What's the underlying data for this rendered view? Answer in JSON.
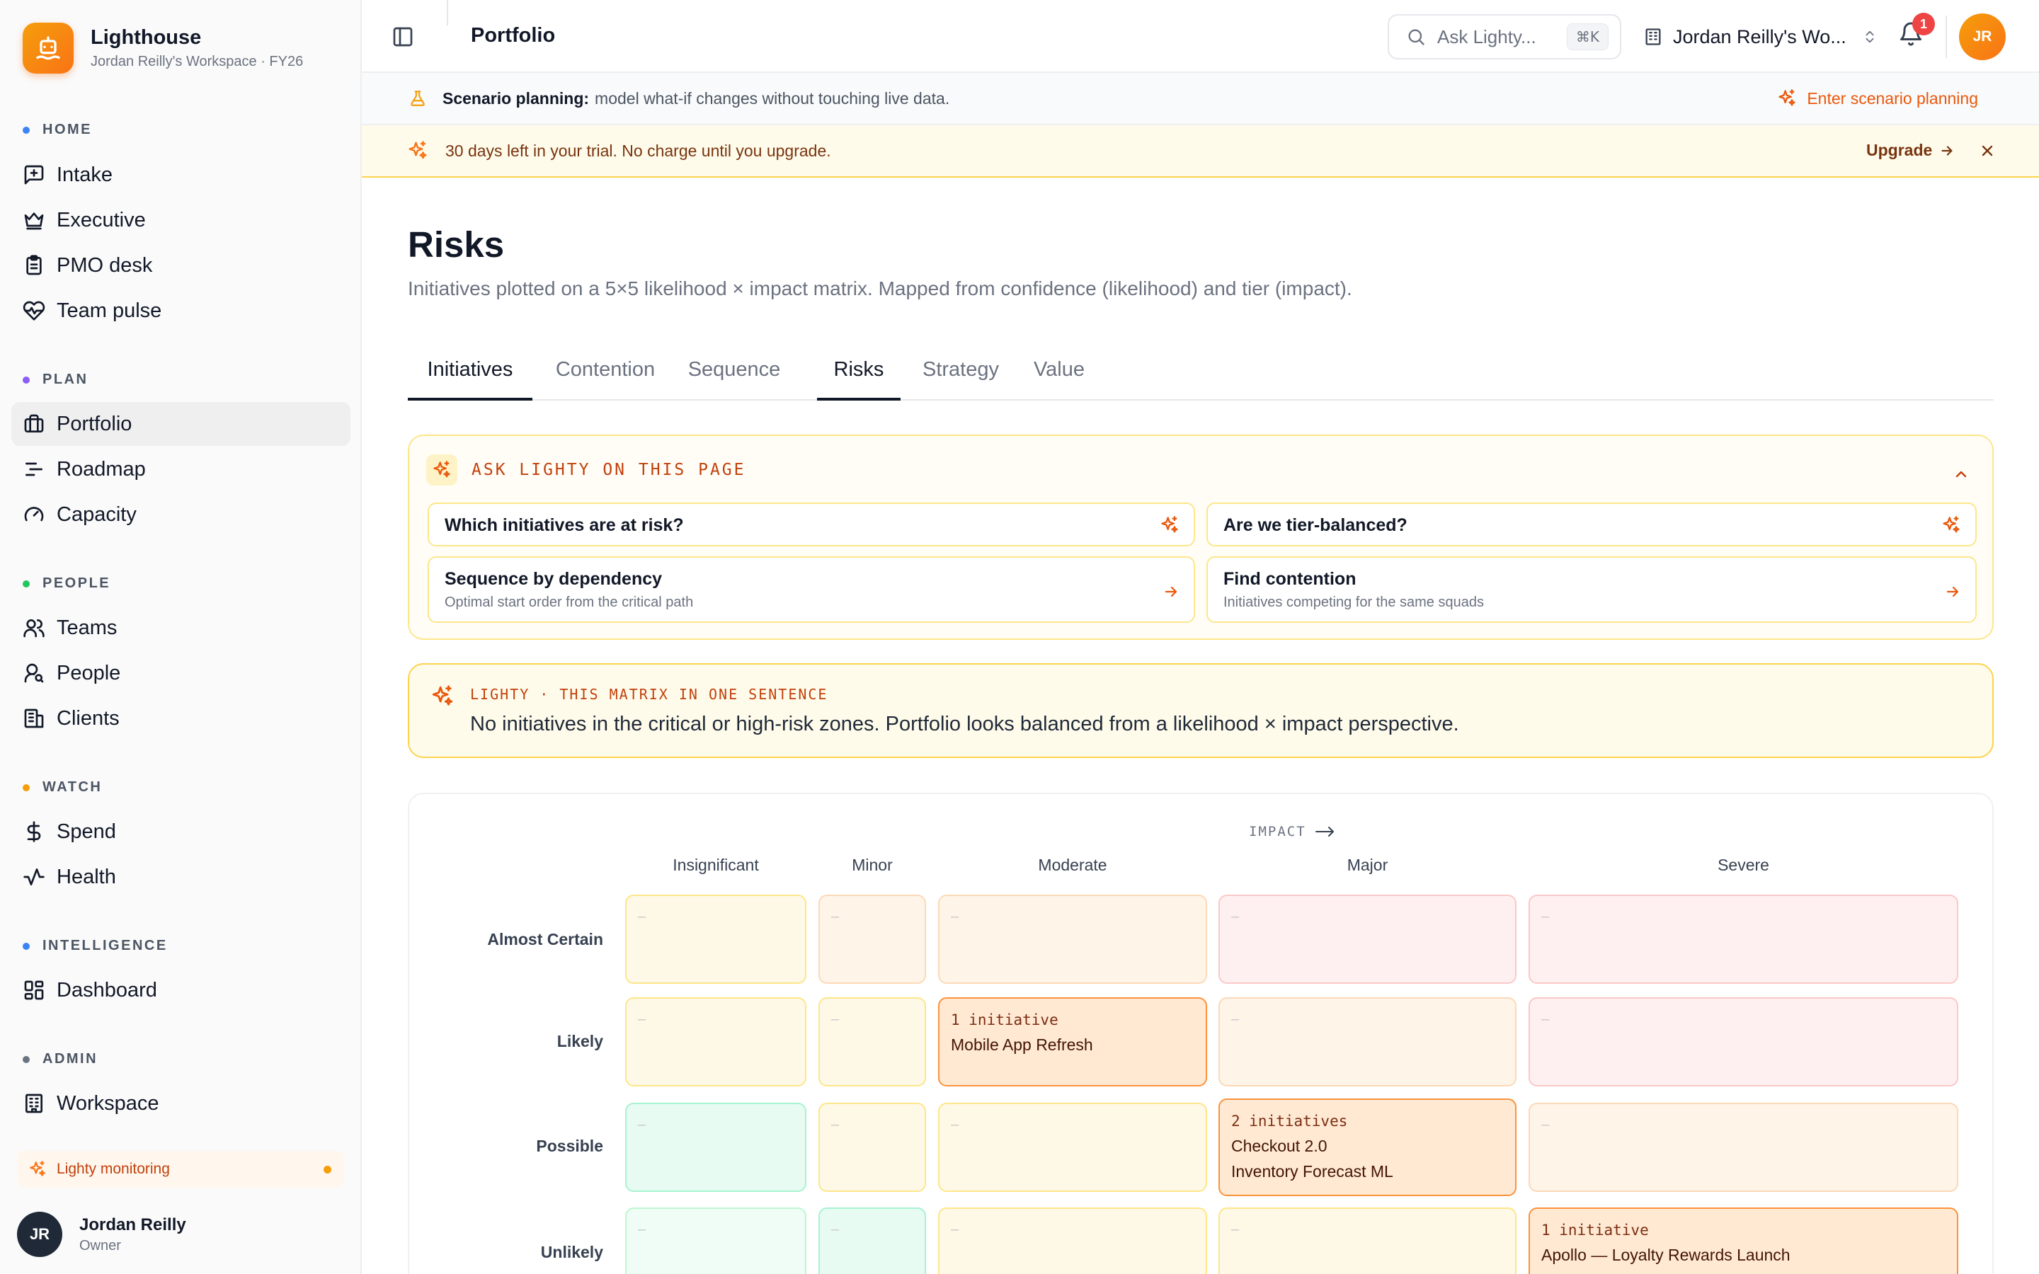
{
  "brand": {
    "name": "Lighthouse",
    "subtitle": "Jordan Reilly's Workspace · FY26"
  },
  "sidebar": {
    "sections": [
      {
        "label": "HOME",
        "color": "#3b82f6"
      },
      {
        "label": "PLAN",
        "color": "#8b5cf6"
      },
      {
        "label": "PEOPLE",
        "color": "#22c55e"
      },
      {
        "label": "WATCH",
        "color": "#f59e0b"
      },
      {
        "label": "INTELLIGENCE",
        "color": "#3b82f6"
      },
      {
        "label": "ADMIN",
        "color": "#6b7280"
      }
    ],
    "items": {
      "intake": "Intake",
      "executive": "Executive",
      "pmo_desk": "PMO desk",
      "team_pulse": "Team pulse",
      "portfolio": "Portfolio",
      "roadmap": "Roadmap",
      "capacity": "Capacity",
      "teams": "Teams",
      "people": "People",
      "clients": "Clients",
      "spend": "Spend",
      "health": "Health",
      "dashboard": "Dashboard",
      "workspace": "Workspace"
    },
    "monitoring": "Lighty monitoring",
    "user": {
      "initials": "JR",
      "name": "Jordan Reilly",
      "role": "Owner"
    }
  },
  "topbar": {
    "title": "Portfolio",
    "search_placeholder": "Ask Lighty...",
    "search_shortcut": "⌘K",
    "workspace": "Jordan Reilly's Wo...",
    "notifications": "1",
    "avatar": "JR"
  },
  "scenario": {
    "strong": "Scenario planning:",
    "text": "model what-if changes without touching live data.",
    "link": "Enter scenario planning"
  },
  "trial": {
    "text": "30 days left in your trial. No charge until you upgrade.",
    "upgrade": "Upgrade"
  },
  "page": {
    "title": "Risks",
    "subtitle": "Initiatives plotted on a 5×5 likelihood × impact matrix. Mapped from confidence (likelihood) and tier (impact)."
  },
  "tabs": [
    "Initiatives",
    "Contention",
    "Sequence",
    "Risks",
    "Strategy",
    "Value"
  ],
  "ask": {
    "heading": "ASK LIGHTY ON THIS PAGE",
    "cards": [
      {
        "title": "Which initiatives are at risk?",
        "sub": ""
      },
      {
        "title": "Are we tier-balanced?",
        "sub": ""
      },
      {
        "title": "Sequence by dependency",
        "sub": "Optimal start order from the critical path"
      },
      {
        "title": "Find contention",
        "sub": "Initiatives competing for the same squads"
      }
    ]
  },
  "summary": {
    "label": "LIGHTY · THIS MATRIX IN ONE SENTENCE",
    "text": "No initiatives in the critical or high-risk zones. Portfolio looks balanced from a likelihood × impact perspective."
  },
  "matrix": {
    "axis_label": "IMPACT",
    "columns": [
      "Insignificant",
      "Minor",
      "Moderate",
      "Major",
      "Severe"
    ],
    "rows": [
      "Almost Certain",
      "Likely",
      "Possible",
      "Unlikely"
    ],
    "empty_marker": "–",
    "cells": {
      "likely_moderate": {
        "count": "1 initiative",
        "items": [
          "Mobile App Refresh"
        ]
      },
      "possible_major": {
        "count": "2 initiatives",
        "items": [
          "Checkout 2.0",
          "Inventory Forecast ML"
        ]
      },
      "unlikely_severe": {
        "count": "1 initiative",
        "items": [
          "Apollo — Loyalty Rewards Launch"
        ]
      }
    }
  }
}
